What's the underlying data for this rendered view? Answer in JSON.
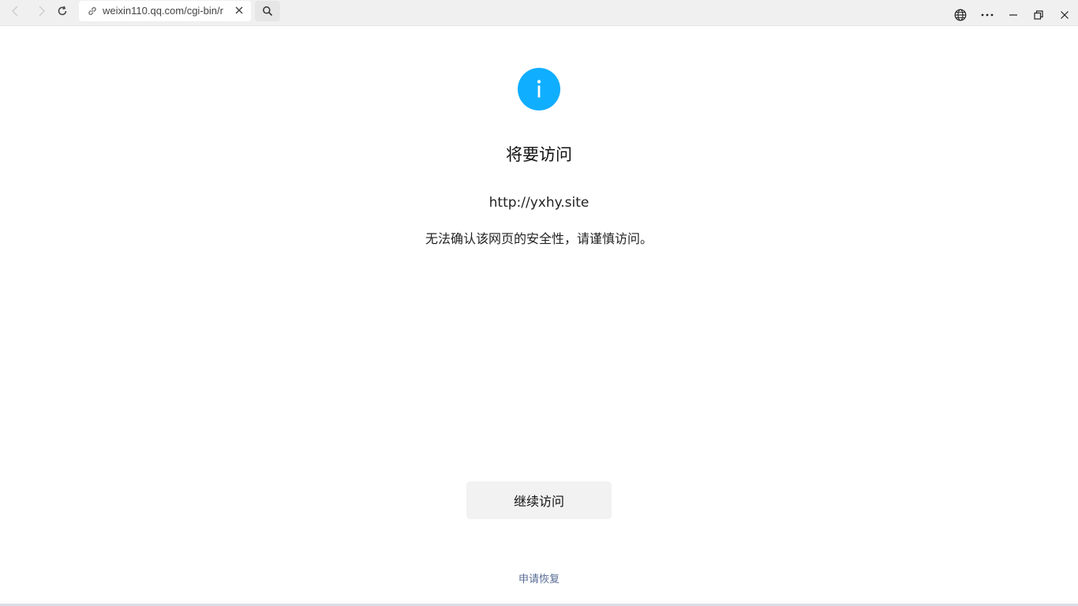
{
  "browser": {
    "url": "weixin110.qq.com/cgi-bin/r",
    "icons": {
      "back": "chevron-left-icon",
      "forward": "chevron-right-icon",
      "reload": "reload-icon",
      "link": "link-icon",
      "close": "close-icon",
      "search": "search-icon",
      "globe": "globe-icon",
      "more": "more-icon",
      "minimize": "minimize-icon",
      "restore": "restore-icon",
      "window_close": "close-icon"
    }
  },
  "page": {
    "title": "将要访问",
    "target_url": "http://yxhy.site",
    "warning": "无法确认该网页的安全性，请谨慎访问。",
    "continue_label": "继续访问",
    "appeal_label": "申请恢复"
  },
  "colors": {
    "info_accent": "#10aeff",
    "link": "#576b95",
    "button_bg": "#f2f2f2"
  }
}
